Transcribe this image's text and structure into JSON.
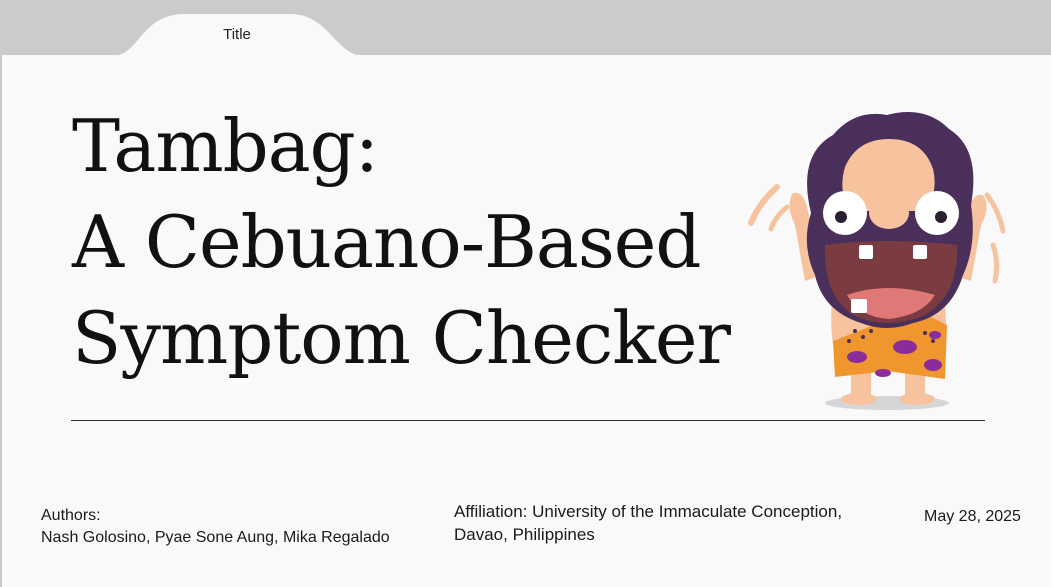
{
  "tab": {
    "label": "Title"
  },
  "slide": {
    "title_lines": [
      "Tambag:",
      "A Cebuano-Based",
      "Symptom Checker"
    ],
    "authors_heading": "Authors:",
    "authors": "Nash Golosino, Pyae Sone Aung, Mika Regalado",
    "affiliation_line1": "Affiliation: University of the Immaculate Conception,",
    "affiliation_line2": "Davao, Philippines",
    "date": "May 28, 2025"
  },
  "icons": {
    "mascot": "caveman-mascot-icon"
  },
  "colors": {
    "tab_bar": "#cbcbcb",
    "slide_bg": "#f9f9f9",
    "hair": "#4a2f5a",
    "skin": "#f6c39e",
    "loincloth": "#f0962e",
    "spots": "#8a2c9a"
  }
}
